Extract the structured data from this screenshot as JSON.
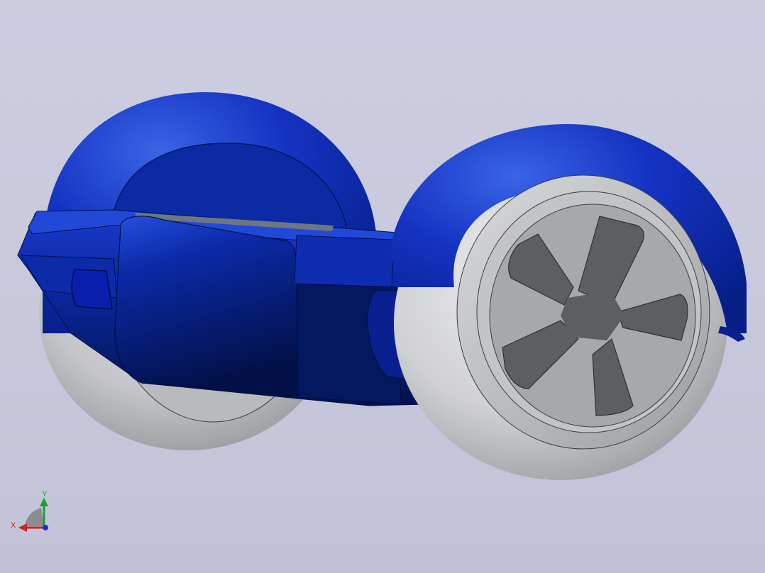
{
  "viewport": {
    "background_top": "#cdcde2",
    "background_bottom": "#c2c2d8"
  },
  "model": {
    "body_color": "#0a2aa8",
    "body_highlight": "#3a64e6",
    "body_shadow": "#04155a",
    "wheel_color": "#c8c9cc",
    "hub_color": "#a9abae",
    "spoke_cutout_color": "#5c5e62"
  },
  "triad": {
    "x_label": "X",
    "y_label": "Y",
    "x_color": "#d22020",
    "y_color": "#18a030",
    "z_color": "#1a30d0"
  }
}
